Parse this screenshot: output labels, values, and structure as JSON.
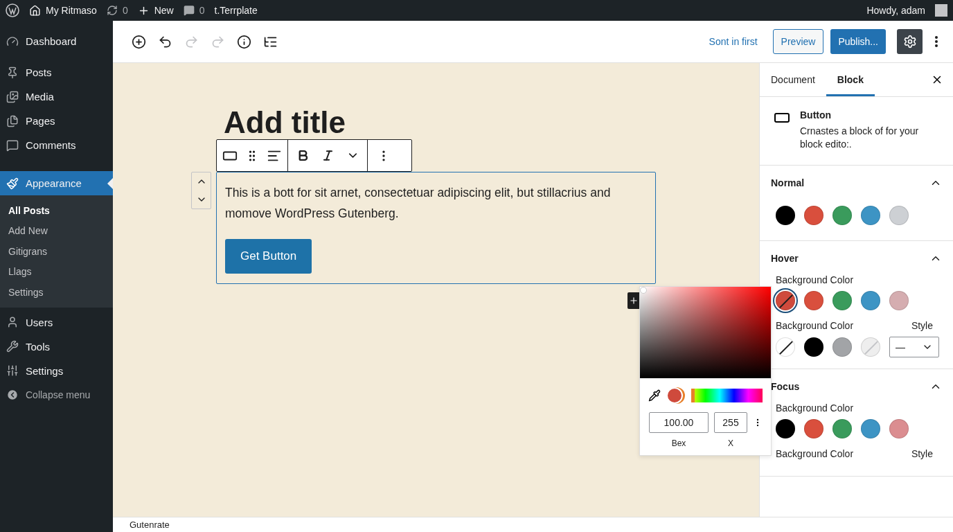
{
  "admin_bar": {
    "site": "My Ritmaso",
    "updates": "0",
    "new": "New",
    "comments": "0",
    "template": "t.Terrplate",
    "greeting": "Howdy, adam"
  },
  "sidebar": {
    "items": [
      {
        "label": "Dashboard",
        "selected": false
      },
      {
        "label": "Posts",
        "selected": false
      },
      {
        "label": "Media",
        "selected": false
      },
      {
        "label": "Pages",
        "selected": false
      },
      {
        "label": "Comments",
        "selected": false
      },
      {
        "label": "Appearance",
        "selected": true,
        "children": [
          {
            "label": "All Posts",
            "selected": true
          },
          {
            "label": "Add New",
            "selected": false
          },
          {
            "label": "Gitigrans",
            "selected": false
          },
          {
            "label": "Llags",
            "selected": false
          },
          {
            "label": "Settings",
            "selected": false
          }
        ]
      },
      {
        "label": "Users",
        "selected": false
      },
      {
        "label": "Tools",
        "selected": false
      },
      {
        "label": "Settings",
        "selected": false
      }
    ],
    "collapse": "Collapse menu"
  },
  "header": {
    "tools": [
      {
        "disabled": false
      },
      {
        "disabled": false
      },
      {
        "disabled": true
      },
      {
        "disabled": true
      },
      {
        "disabled": false
      },
      {
        "disabled": false
      }
    ],
    "link": "Sont in first",
    "preview": "Preview",
    "publish": "Publish...",
    "settings_active": true
  },
  "canvas": {
    "title": "Add title",
    "paragraph": "This is a bott for sit arnet, consectetuar adipiscing elit, but stillacrius and momove WordPress Gutenberg.",
    "button": "Get Button"
  },
  "color_picker": {
    "value": "100.00",
    "alpha": "255",
    "value_label": "Bex",
    "alpha_label": "X",
    "hue_slider": {
      "level": 0
    }
  },
  "panel": {
    "tabs": [
      {
        "label": "Document",
        "selected": false
      },
      {
        "label": "Block",
        "selected": true
      }
    ],
    "block": {
      "name": "Button",
      "description": "Crnastes a block of for your block edito:."
    },
    "sections": [
      {
        "title": "Normal",
        "expanded": true,
        "groups": [
          {
            "swatches": [
              {
                "kind": "solid",
                "color": "#000000",
                "selected": false
              },
              {
                "kind": "solid",
                "color": "#d94f3d",
                "selected": false
              },
              {
                "kind": "solid",
                "color": "#3a9b5c",
                "selected": false
              },
              {
                "kind": "solid",
                "color": "#3d94c4",
                "selected": false
              },
              {
                "kind": "solid",
                "color": "#cdd0d4",
                "selected": false
              }
            ]
          }
        ]
      },
      {
        "title": "Hover",
        "expanded": true,
        "groups": [
          {
            "label": "Background Color",
            "swatches": [
              {
                "kind": "clear",
                "color": "#cf4a3c",
                "selected": true
              },
              {
                "kind": "solid",
                "color": "#d94f3d",
                "selected": false
              },
              {
                "kind": "solid",
                "color": "#3a9b5c",
                "selected": false
              },
              {
                "kind": "solid",
                "color": "#3d94c4",
                "selected": false
              },
              {
                "kind": "solid",
                "color": "#d5adb0",
                "selected": false
              }
            ]
          },
          {
            "label": "Background Color",
            "style_label": "Style",
            "style_value": "—",
            "swatches": [
              {
                "kind": "clear",
                "color": "#ffffff",
                "selected": false
              },
              {
                "kind": "solid",
                "color": "#000000",
                "selected": false
              },
              {
                "kind": "solid",
                "color": "#a2a4a7",
                "selected": false
              },
              {
                "kind": "clear",
                "color": "#eeeeee",
                "selected": false
              }
            ]
          }
        ]
      },
      {
        "title": "Focus",
        "expanded": true,
        "groups": [
          {
            "label": "Background Color",
            "swatches": [
              {
                "kind": "solid",
                "color": "#000000",
                "selected": false
              },
              {
                "kind": "solid",
                "color": "#d94f3d",
                "selected": false
              },
              {
                "kind": "solid",
                "color": "#3a9b5c",
                "selected": false
              },
              {
                "kind": "solid",
                "color": "#3d94c4",
                "selected": false
              },
              {
                "kind": "solid",
                "color": "#db8d90",
                "selected": false
              }
            ]
          },
          {
            "label": "Background Color",
            "style_label": "Style"
          }
        ]
      }
    ]
  },
  "footer": "Gutenrate"
}
